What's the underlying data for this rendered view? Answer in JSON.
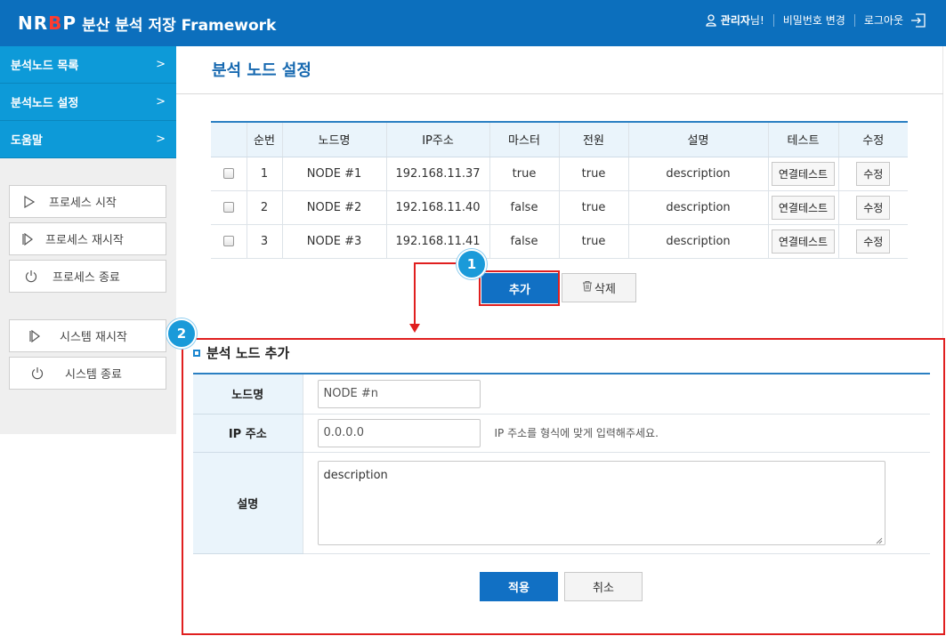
{
  "header": {
    "logo_prefix": "NR",
    "logo_b": "B",
    "logo_suffix": "P",
    "logo_text": "분산 분석 저장 Framework",
    "admin_name": "관리자",
    "admin_suffix": "님!",
    "change_password": "비밀번호 변경",
    "logout": "로그아웃"
  },
  "sidebar": {
    "menu": [
      {
        "label": "분석노드 목록",
        "chevron": ">"
      },
      {
        "label": "분석노드 설정",
        "chevron": ">"
      },
      {
        "label": "도움말",
        "chevron": ">"
      }
    ],
    "buttons": {
      "process_start": "프로세스 시작",
      "process_restart": "프로세스 재시작",
      "process_stop": "프로세스 종료",
      "system_restart": "시스템 재시작",
      "system_stop": "시스템 종료"
    }
  },
  "main": {
    "title": "분석 노드 설정",
    "table": {
      "headers": [
        "",
        "순번",
        "노드명",
        "IP주소",
        "마스터",
        "전원",
        "설명",
        "테스트",
        "수정"
      ],
      "rows": [
        {
          "no": "1",
          "name": "NODE #1",
          "ip": "192.168.11.37",
          "master": "true",
          "power": "true",
          "desc": "description",
          "test": "연결테스트",
          "edit": "수정"
        },
        {
          "no": "2",
          "name": "NODE #2",
          "ip": "192.168.11.40",
          "master": "false",
          "power": "true",
          "desc": "description",
          "test": "연결테스트",
          "edit": "수정"
        },
        {
          "no": "3",
          "name": "NODE #3",
          "ip": "192.168.11.41",
          "master": "false",
          "power": "true",
          "desc": "description",
          "test": "연결테스트",
          "edit": "수정"
        }
      ]
    },
    "add_button": "추가",
    "delete_button": "삭제"
  },
  "annotations": {
    "badge1": "1",
    "badge2": "2",
    "highlight_color": "#e01f1f",
    "badge_color": "#1a9ad9"
  },
  "form": {
    "title": "분석 노드 추가",
    "name_label": "노드명",
    "name_placeholder": "NODE #n",
    "ip_label": "IP 주소",
    "ip_placeholder": "0.0.0.0",
    "ip_hint": "IP 주소를 형식에 맞게 입력해주세요.",
    "desc_label": "설명",
    "desc_value": "description",
    "apply_button": "적용",
    "cancel_button": "취소"
  },
  "colors": {
    "header_bg": "#0c6fbd",
    "menu_bg": "#0d9ad8",
    "primary_button": "#1170c4"
  }
}
